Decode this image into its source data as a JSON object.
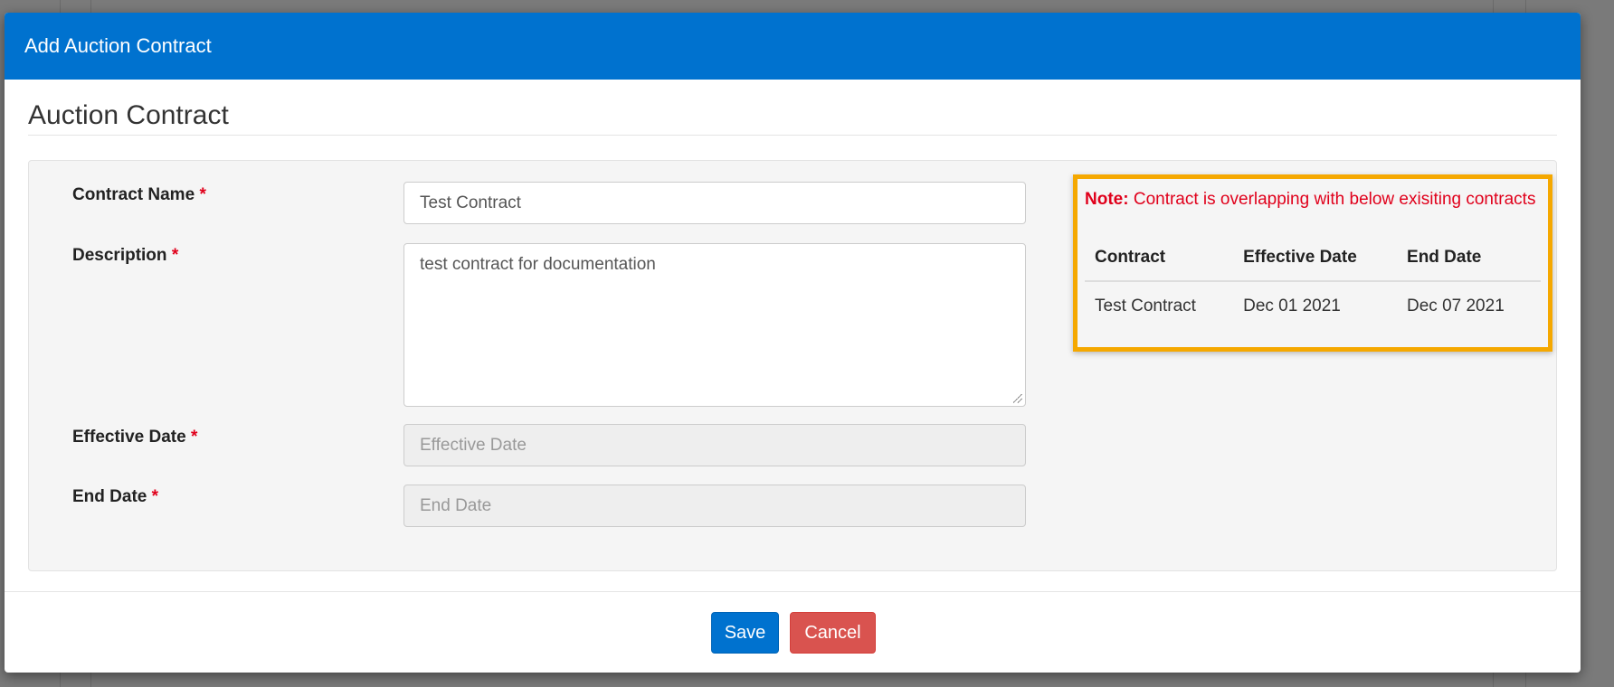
{
  "modal": {
    "title": "Add Auction Contract",
    "section_title": "Auction Contract"
  },
  "form": {
    "required_marker": "*",
    "contract_name": {
      "label": "Contract Name",
      "value": "Test Contract"
    },
    "description": {
      "label": "Description",
      "value": "test contract for documentation"
    },
    "effective_date": {
      "label": "Effective Date",
      "placeholder": "Effective Date"
    },
    "end_date": {
      "label": "End Date",
      "placeholder": "End Date"
    }
  },
  "note": {
    "prefix": "Note:",
    "message": "Contract is overlapping with below exisiting contracts",
    "color": "#e0001b",
    "border_color": "#f5a800",
    "table": {
      "headers": [
        "Contract",
        "Effective Date",
        "End Date"
      ],
      "rows": [
        [
          "Test Contract",
          "Dec 01 2021",
          "Dec 07 2021"
        ]
      ]
    }
  },
  "buttons": {
    "save": "Save",
    "cancel": "Cancel"
  },
  "colors": {
    "header": "#0072cf",
    "save": "#0072cf",
    "cancel": "#d9534f"
  }
}
